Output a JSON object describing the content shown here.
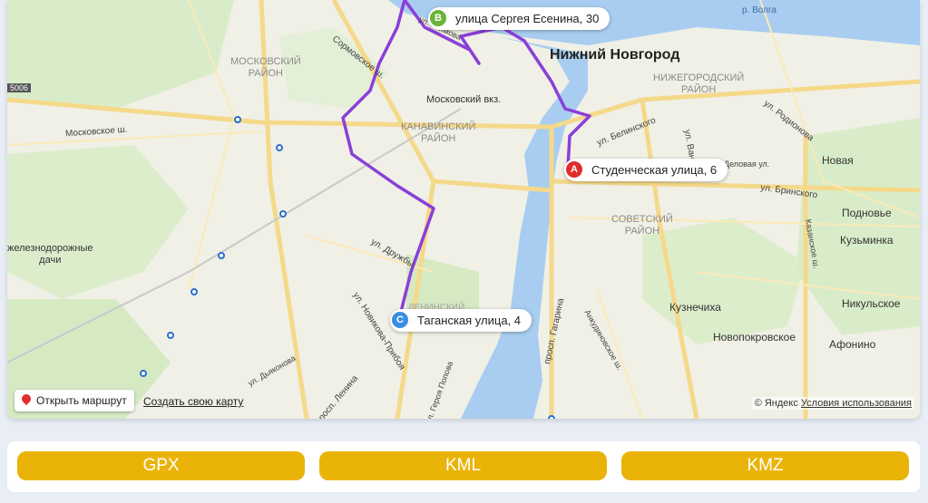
{
  "map": {
    "city_label": "Нижний Новгород",
    "districts": [
      {
        "name": "МОСКОВСКИЙ\nРАЙОН"
      },
      {
        "name": "КАНАВИНСКИЙ\nРАЙОН"
      },
      {
        "name": "НИЖЕГОРОДСКИЙ\nРАЙОН"
      },
      {
        "name": "СОВЕТСКИЙ\nРАЙОН"
      },
      {
        "name": "ЛЕНИНСКИЙ"
      }
    ],
    "places": [
      "Новая",
      "Подновье",
      "Кузьминка",
      "Никульское",
      "Афонино",
      "Кузнечиха",
      "Новопокровское",
      "железнодорожные\nдачи",
      "р. Волга"
    ],
    "streets": [
      "Сормовское ш.",
      "Московское ш.",
      "ул. Белинского",
      "ул. Родионова",
      "ул. Ванеева",
      "ул. Бринского",
      "Деловая ул.",
      "Казанское ш.",
      "ул. Дружбы",
      "просп. Гагарина",
      "ул. Новикова-Прибоя",
      "ул. Дьяконова",
      "ул. Героя Попова",
      "просп. Ленина",
      "Московский вкз.",
      "Анкудиновское ш.",
      "ул. Акимова",
      "5006"
    ],
    "markers": {
      "a": {
        "letter": "A",
        "label": "Студенческая улица, 6"
      },
      "b": {
        "letter": "B",
        "label": "улица Сергея Есенина, 30"
      },
      "c": {
        "letter": "C",
        "label": "Таганская улица, 4"
      }
    },
    "open_route_label": "Открыть маршрут",
    "create_map_label": "Создать свою карту",
    "copyright": "© Яндекс",
    "terms_label": "Условия использования"
  },
  "buttons": {
    "gpx": "GPX",
    "kml": "KML",
    "kmz": "KMZ"
  },
  "colors": {
    "route": "#8a3fd9",
    "water": "#a8cdf0",
    "button": "#eab308",
    "marker_a": "#e02c2c",
    "marker_b": "#6bb33a",
    "marker_c": "#3a8de0"
  }
}
